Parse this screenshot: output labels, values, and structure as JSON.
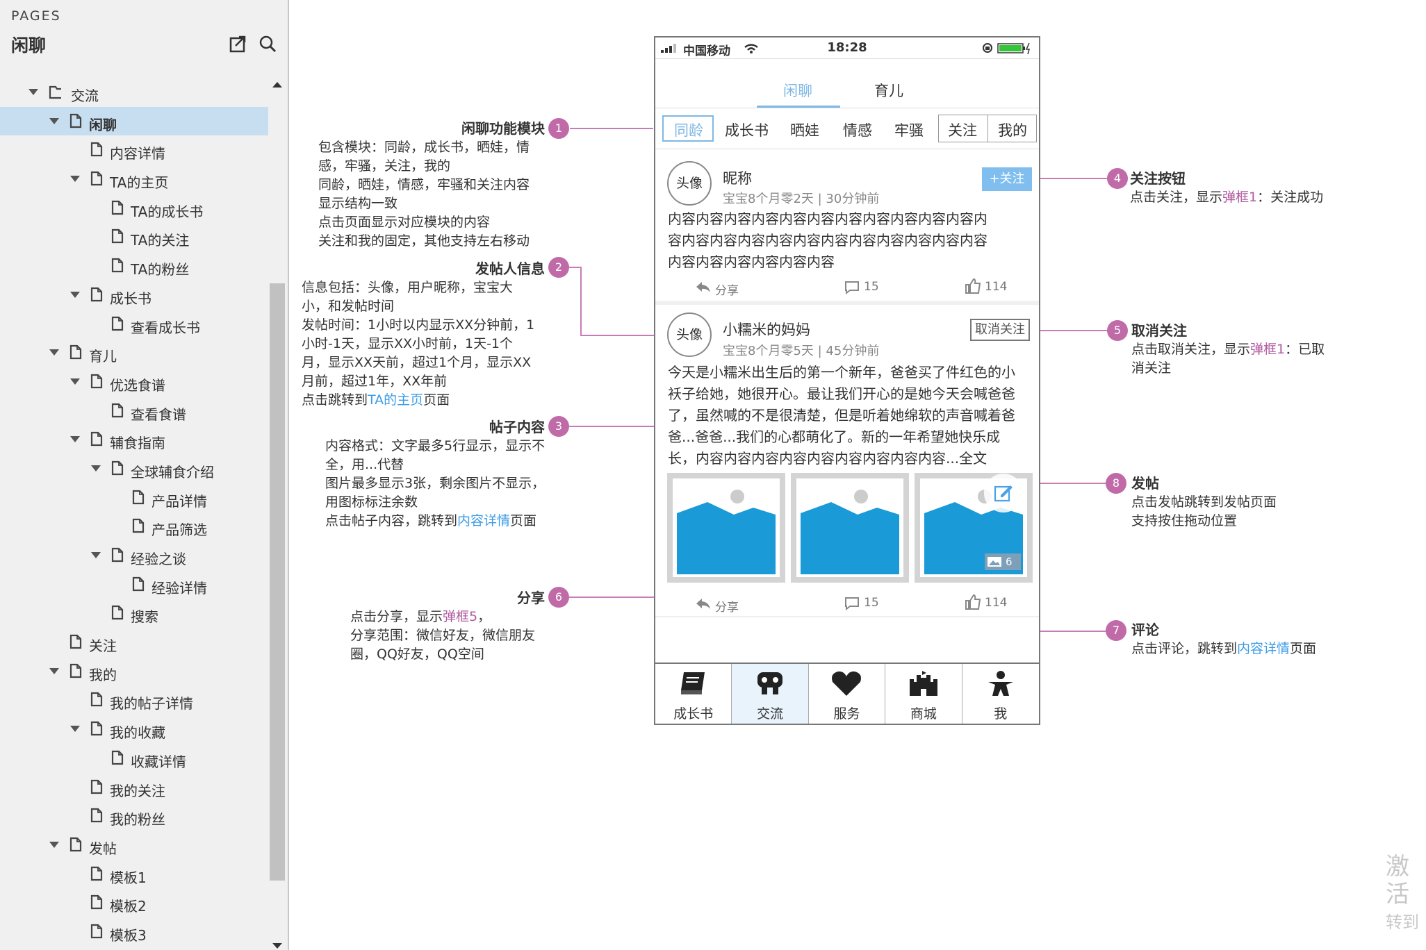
{
  "sidebar": {
    "pages_label": "PAGES",
    "title": "闲聊",
    "tree": [
      {
        "label": "交流",
        "type": "folder",
        "level": 0,
        "expanded": true
      },
      {
        "label": "闲聊",
        "type": "page",
        "level": 1,
        "expanded": true,
        "selected": true
      },
      {
        "label": "内容详情",
        "type": "page",
        "level": 2
      },
      {
        "label": "TA的主页",
        "type": "page",
        "level": 2,
        "expanded": true
      },
      {
        "label": "TA的成长书",
        "type": "page",
        "level": 3
      },
      {
        "label": "TA的关注",
        "type": "page",
        "level": 3
      },
      {
        "label": "TA的粉丝",
        "type": "page",
        "level": 3
      },
      {
        "label": "成长书",
        "type": "page",
        "level": 2,
        "expanded": true
      },
      {
        "label": "查看成长书",
        "type": "page",
        "level": 3
      },
      {
        "label": "育儿",
        "type": "page",
        "level": 1,
        "expanded": true
      },
      {
        "label": "优选食谱",
        "type": "page",
        "level": 2,
        "expanded": true
      },
      {
        "label": "查看食谱",
        "type": "page",
        "level": 3
      },
      {
        "label": "辅食指南",
        "type": "page",
        "level": 2,
        "expanded": true
      },
      {
        "label": "全球辅食介绍",
        "type": "page",
        "level": 3,
        "expanded": true
      },
      {
        "label": "产品详情",
        "type": "page",
        "level": 4
      },
      {
        "label": "产品筛选",
        "type": "page",
        "level": 4
      },
      {
        "label": "经验之谈",
        "type": "page",
        "level": 3,
        "expanded": true
      },
      {
        "label": "经验详情",
        "type": "page",
        "level": 4
      },
      {
        "label": "搜索",
        "type": "page",
        "level": 3
      },
      {
        "label": "关注",
        "type": "page",
        "level": 1
      },
      {
        "label": "我的",
        "type": "page",
        "level": 1,
        "expanded": true
      },
      {
        "label": "我的帖子详情",
        "type": "page",
        "level": 2
      },
      {
        "label": "我的收藏",
        "type": "page",
        "level": 2,
        "expanded": true
      },
      {
        "label": "收藏详情",
        "type": "page",
        "level": 3
      },
      {
        "label": "我的关注",
        "type": "page",
        "level": 2
      },
      {
        "label": "我的粉丝",
        "type": "page",
        "level": 2
      },
      {
        "label": "发帖",
        "type": "page",
        "level": 1,
        "expanded": true
      },
      {
        "label": "模板1",
        "type": "page",
        "level": 2
      },
      {
        "label": "模板2",
        "type": "page",
        "level": 2
      },
      {
        "label": "模板3",
        "type": "page",
        "level": 2
      }
    ]
  },
  "phone": {
    "status": {
      "carrier": "中国移动",
      "time": "18:28"
    },
    "top_tabs": [
      "闲聊",
      "育儿"
    ],
    "categories": [
      "同龄",
      "成长书",
      "晒娃",
      "情感",
      "牢骚",
      "关注",
      "我的"
    ],
    "post1": {
      "avatar": "头像",
      "nickname": "昵称",
      "meta": "宝宝8个月零2天 |  30分钟前",
      "follow": "+关注",
      "content": [
        "内容内容内容内容内容内容内容内容内容内容内容内",
        "容内容内容内容内容内容内容内容内容内容内容内容",
        "内容内容内容内容内容内容"
      ],
      "share": "分享",
      "comments": "15",
      "likes": "114"
    },
    "post2": {
      "avatar": "头像",
      "nickname": "小糯米的妈妈",
      "meta": "宝宝8个月零5天 |  45分钟前",
      "unfollow": "取消关注",
      "content": [
        "今天是小糯米出生后的第一个新年，爸爸买了件红色的小",
        "袄子给她，她很开心。最让我们开心的是她今天会喊爸爸",
        "了，虽然喊的不是很清楚，但是听着她绵软的声音喊着爸",
        "爸...爸爸...我们的心都萌化了。新的一年希望她快乐成",
        "长，内容内容内容内容内容内容内容内容内容...全文"
      ],
      "image_count": "6",
      "share": "分享",
      "comments": "15",
      "likes": "114"
    },
    "bottom_nav": [
      "成长书",
      "交流",
      "服务",
      "商城",
      "我"
    ]
  },
  "annotations": {
    "a1": {
      "num": "1",
      "title": "闲聊功能模块",
      "lines": [
        "包含模块：同龄，成长书，晒娃，情",
        "感，牢骚，关注，我的",
        "同龄，晒娃，情感，牢骚和关注内容",
        "显示结构一致",
        "点击页面显示对应模块的内容",
        "关注和我的固定，其他支持左右移动"
      ]
    },
    "a2": {
      "num": "2",
      "title": "发帖人信息",
      "lines": [
        "信息包括：头像，用户昵称，宝宝大",
        "小，和发帖时间",
        "发帖时间：1小时以内显示XX分钟前，1",
        "小时-1天，显示XX小时前，1天-1个",
        "月，显示XX天前，超过1个月，显示XX",
        "月前，超过1年，XX年前"
      ],
      "last_pre": "点击跳转到",
      "last_link": "TA的主页",
      "last_post": "页面"
    },
    "a3": {
      "num": "3",
      "title": "帖子内容",
      "lines": [
        "内容格式：文字最多5行显示，显示不",
        "全，用...代替",
        "图片最多显示3张，剩余图片不显示，",
        "用图标标注余数"
      ],
      "last_pre": "点击帖子内容，跳转到",
      "last_link": "内容详情",
      "last_post": "页面"
    },
    "a4": {
      "num": "4",
      "title": "关注按钮",
      "pre": "点击关注，显示",
      "link": "弹框1",
      "post": "：关注成功"
    },
    "a5": {
      "num": "5",
      "title": "取消关注",
      "pre": "点击取消关注，显示",
      "link": "弹框1",
      "post": "：已取",
      "line2": "消关注"
    },
    "a6": {
      "num": "6",
      "title": "分享",
      "pre": "点击分享，显示",
      "link": "弹框5",
      "post": "，",
      "line2": "分享范围：微信好友，微信朋友",
      "line3": "圈，QQ好友，QQ空间"
    },
    "a7": {
      "num": "7",
      "title": "评论",
      "pre": "点击评论，跳转到",
      "link": "内容详情",
      "post": "页面"
    },
    "a8": {
      "num": "8",
      "title": "发帖",
      "line1": "点击发帖跳转到发帖页面",
      "line2": "支持按住拖动位置"
    }
  },
  "watermark": {
    "line1": "激活",
    "line2": "转到"
  },
  "colors": {
    "accent": "#3b9ce8",
    "annotation": "#c06ba8",
    "selected": "#c7def0",
    "image_blue": "#1a9ad6"
  }
}
